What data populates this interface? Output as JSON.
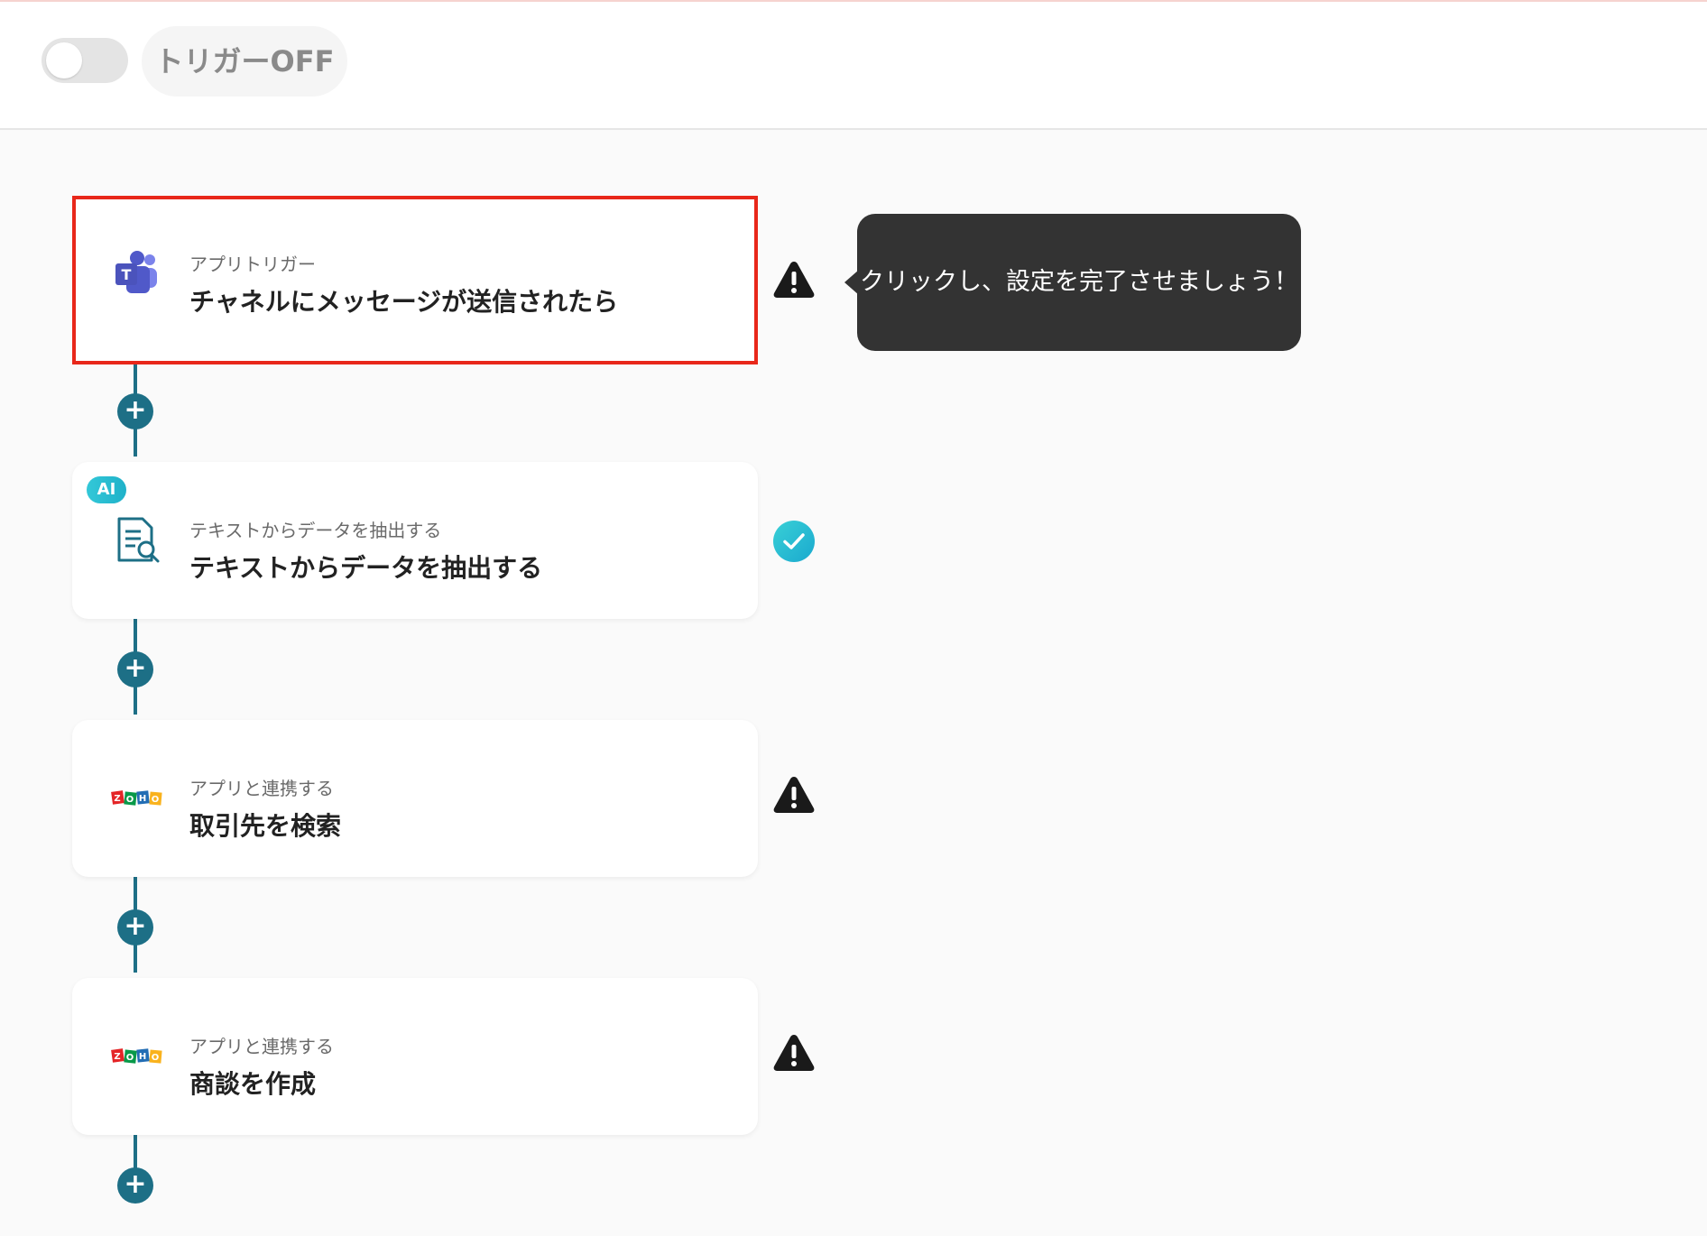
{
  "header": {
    "trigger_status_label": "トリガーOFF",
    "trigger_enabled": false
  },
  "flow": {
    "steps": [
      {
        "category": "アプリトリガー",
        "title": "チャネルにメッセージが送信されたら",
        "icon": "microsoft-teams-icon",
        "status": "warning",
        "selected": true
      },
      {
        "badge": "AI",
        "category": "テキストからデータを抽出する",
        "title": "テキストからデータを抽出する",
        "icon": "document-search-icon",
        "status": "complete"
      },
      {
        "category": "アプリと連携する",
        "title": "取引先を検索",
        "icon": "zoho-icon",
        "status": "warning"
      },
      {
        "category": "アプリと連携する",
        "title": "商談を作成",
        "icon": "zoho-icon",
        "status": "warning"
      }
    ],
    "add_step_symbol": "+"
  },
  "tooltip": {
    "text": "クリックし、設定を完了させましょう！"
  },
  "colors": {
    "accent": "#1d6f86",
    "selected_border": "#e8271a",
    "tooltip_bg": "#333333",
    "check": "#2bbfd6",
    "ai_badge": "#33c8d8"
  }
}
